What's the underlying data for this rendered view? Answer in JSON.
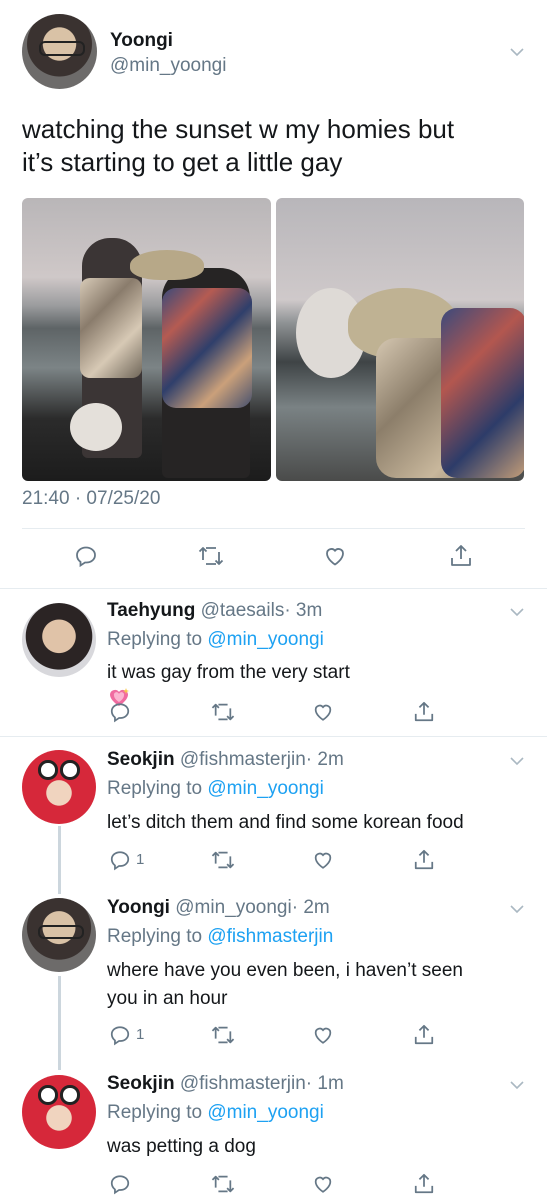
{
  "main_tweet": {
    "author_name": "Yoongi",
    "author_handle": "@min_yoongi",
    "text_line_1": "watching the sunset w my homies but",
    "text_line_2": "it’s starting to get a little gay",
    "timestamp": "21:40 · 07/25/20"
  },
  "replies": [
    {
      "name": "Taehyung",
      "handle": "@taesails",
      "time": "· 3m",
      "replying_label": "Replying to",
      "replying_to": "@min_yoongi",
      "text_line_1": "it was gay from the very start",
      "emoji": "sparkling-heart",
      "reply_count": ""
    },
    {
      "name": "Seokjin",
      "handle": "@fishmasterjin",
      "time": "· 2m",
      "replying_label": "Replying to",
      "replying_to": "@min_yoongi",
      "text_line_1": "let’s ditch them and find some korean food",
      "reply_count": "1"
    },
    {
      "name": "Yoongi",
      "handle": "@min_yoongi",
      "time": "· 2m",
      "replying_label": "Replying to",
      "replying_to": "@fishmasterjin",
      "text_line_1": "where have you even been, i haven’t seen",
      "text_line_2": "you in an hour",
      "reply_count": "1"
    },
    {
      "name": "Seokjin",
      "handle": "@fishmasterjin",
      "time": "· 1m",
      "replying_label": "Replying to",
      "replying_to": "@min_yoongi",
      "text_line_1": "was petting a dog",
      "reply_count": ""
    }
  ],
  "icons": {
    "reply": "reply-icon",
    "retweet": "retweet-icon",
    "like": "heart-icon",
    "share": "share-icon",
    "menu": "chevron-down-icon"
  },
  "colors": {
    "link": "#1da1f2",
    "secondary_text": "#657786",
    "divider": "#e6ecf0",
    "thread_line": "#ccd6dd"
  }
}
